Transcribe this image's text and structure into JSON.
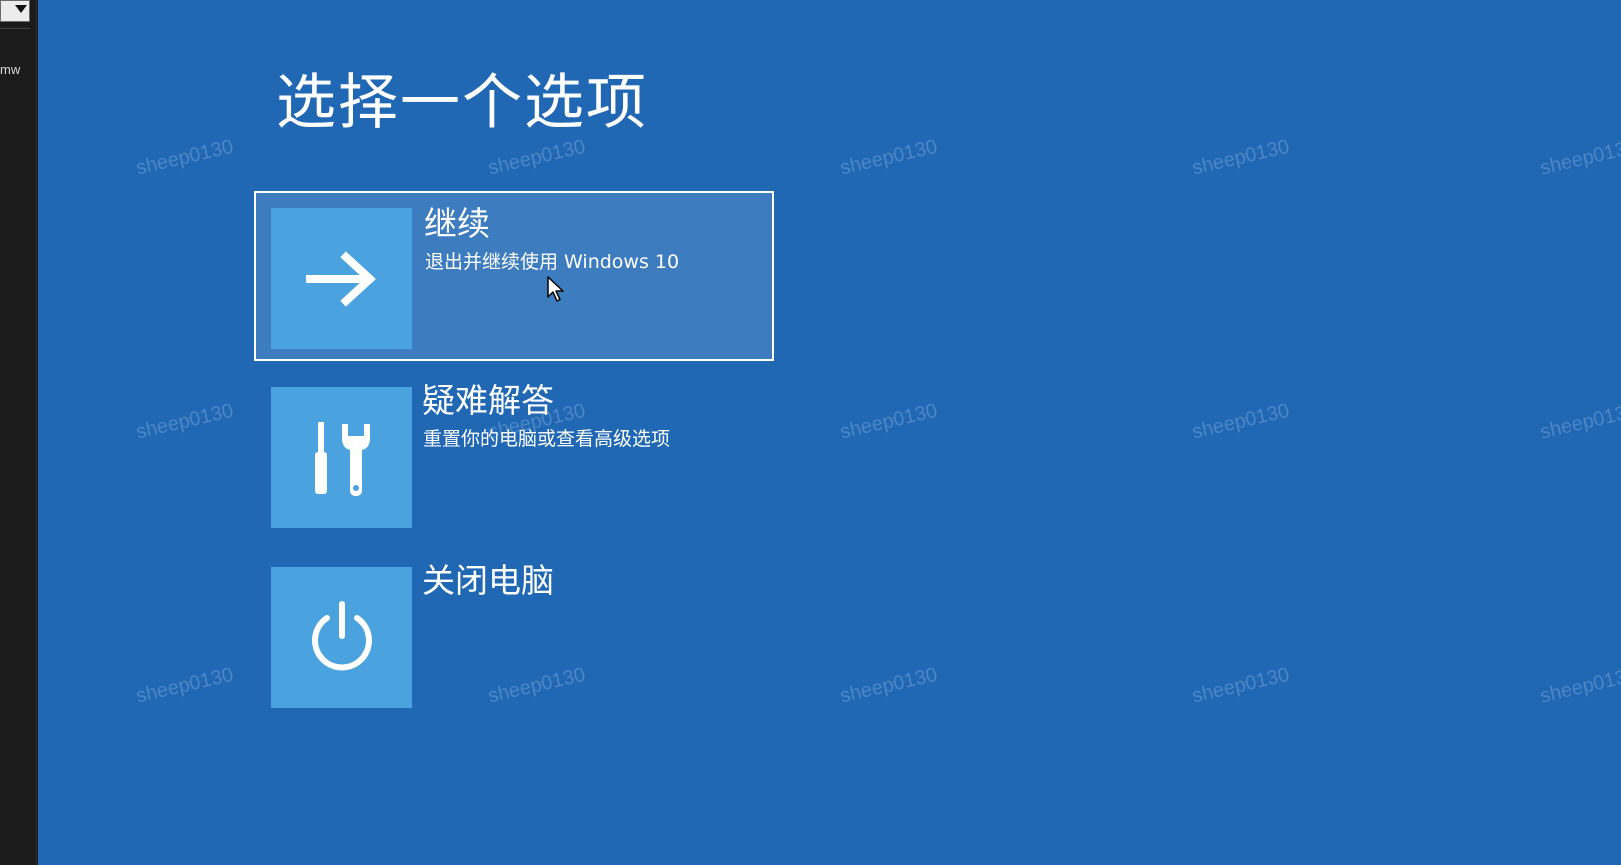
{
  "left_panel": {
    "text": "mw"
  },
  "screen": {
    "title": "选择一个选项",
    "options": [
      {
        "label": "继续",
        "description": "退出并继续使用 Windows 10",
        "icon": "arrow-right-icon",
        "selected": true
      },
      {
        "label": "疑难解答",
        "description": "重置你的电脑或查看高级选项",
        "icon": "tools-icon",
        "selected": false
      },
      {
        "label": "关闭电脑",
        "description": "",
        "icon": "power-icon",
        "selected": false
      }
    ],
    "watermark": "sheep0130"
  },
  "colors": {
    "background": "#2067b4",
    "tile": "#4aa3df",
    "selected_bg": "#3d7cbf",
    "text": "#ffffff"
  }
}
